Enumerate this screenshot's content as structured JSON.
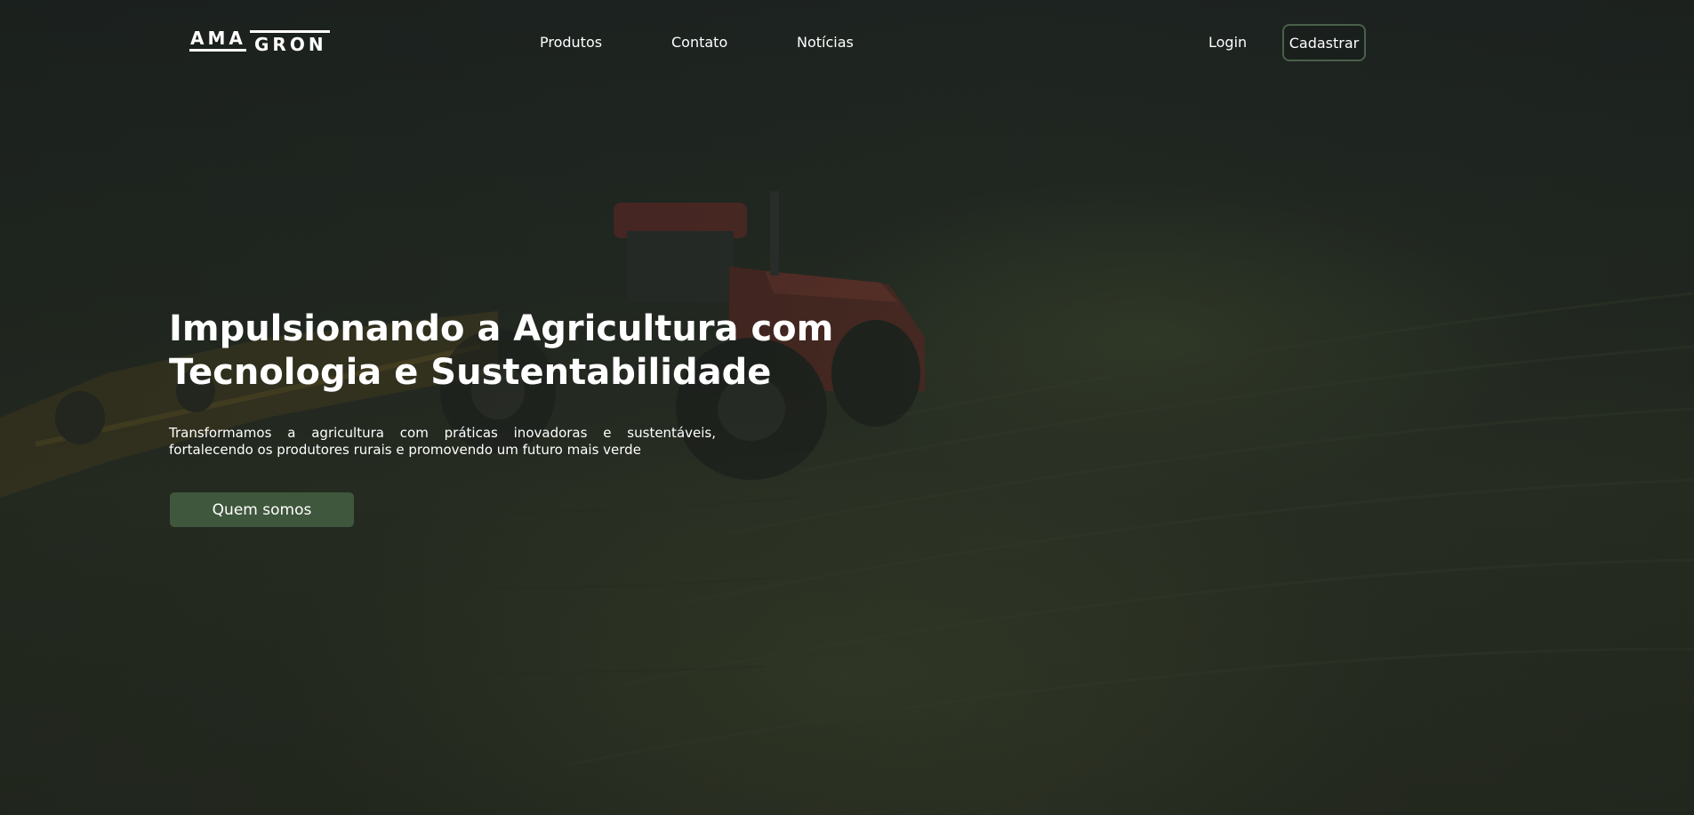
{
  "brand": {
    "logo_left": "AMA",
    "logo_right": "GRON"
  },
  "nav": {
    "items": [
      {
        "label": "Produtos"
      },
      {
        "label": "Contato"
      },
      {
        "label": "Notícias"
      }
    ],
    "login_label": "Login",
    "signup_label": "Cadastrar"
  },
  "hero": {
    "title_line1": "Impulsionando a Agricultura com",
    "title_line2": "Tecnologia e Sustentabilidade",
    "subtitle": "Transformamos a agricultura com práticas inovadoras e sustentáveis, fortalecendo os produtores rurais e promovendo um futuro mais verde",
    "cta_label": "Quem somos"
  },
  "colors": {
    "accent_button": "#3f573c",
    "signup_border": "#4a6049",
    "background": "#1c211c",
    "text": "#ffffff"
  }
}
